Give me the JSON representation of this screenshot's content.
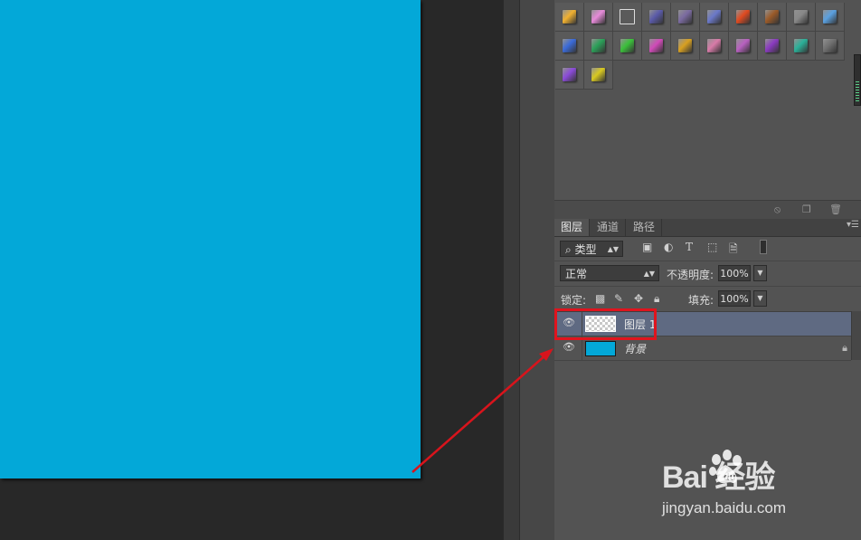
{
  "colors": {
    "document_fill": "#03a8d8",
    "selected_layer": "#5f6a82",
    "annotation_red": "#e0141e"
  },
  "styles_panel": {
    "swatches": [
      "#f0b030",
      "#e68ad8",
      "#6a6a6a",
      "#5a5aa8",
      "#7a6aa0",
      "#6a78c8",
      "#e04a20",
      "#9a5a28",
      "#888888",
      "#5aa0e0",
      "#3a6ad8",
      "#2aa058",
      "#3ac03a",
      "#d04ab8",
      "#d8a020",
      "#d87aa8",
      "#b860c0",
      "#8a3ac0",
      "#2ab098",
      "#707070",
      "#8a4ad8",
      "#d8c820"
    ]
  },
  "layers_panel": {
    "tabs": [
      "图层",
      "通道",
      "路径"
    ],
    "active_tab": "图层",
    "filter": {
      "label": "类型",
      "icon": "search-icon"
    },
    "blend_mode": "正常",
    "opacity_label": "不透明度:",
    "opacity_value": "100%",
    "lock_label": "锁定:",
    "fill_label": "填充:",
    "fill_value": "100%",
    "layers": [
      {
        "name": "图层 1",
        "visible": true,
        "selected": true,
        "thumb": "transparent",
        "locked": false
      },
      {
        "name": "背景",
        "visible": true,
        "selected": false,
        "thumb": "blue",
        "locked": true
      }
    ]
  },
  "watermark": {
    "logo": "Bai  经验",
    "url": "jingyan.baidu.com"
  }
}
